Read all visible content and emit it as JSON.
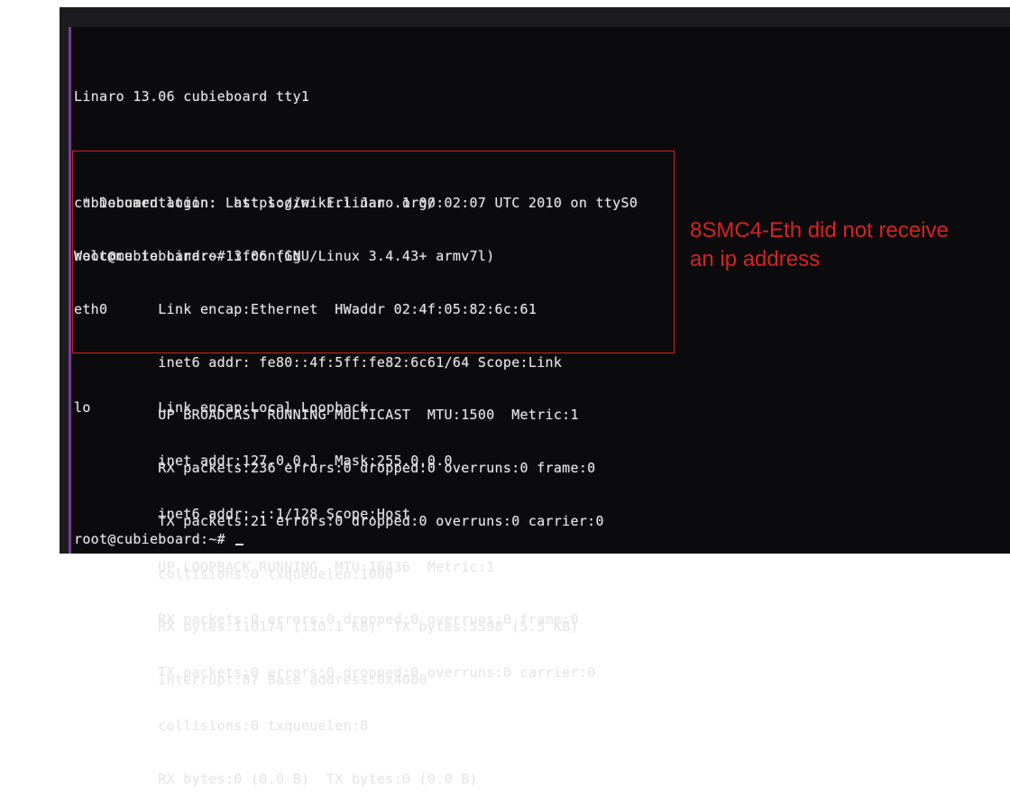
{
  "terminal": {
    "header_lines": [
      "Linaro 13.06 cubieboard tty1",
      "",
      "cubieboard login: Last login: Fri Jan  1 00:02:07 UTC 2010 on ttyS0",
      "Welcome to Linaro 13.06 (GNU/Linux 3.4.43+ armv7l)"
    ],
    "boxed_lines": [
      " * Documentation:  https://wiki.linaro.org/",
      "root@cubieboard:~# ifconfig",
      "eth0      Link encap:Ethernet  HWaddr 02:4f:05:82:6c:61",
      "          inet6 addr: fe80::4f:5ff:fe82:6c61/64 Scope:Link",
      "          UP BROADCAST RUNNING MULTICAST  MTU:1500  Metric:1",
      "          RX packets:236 errors:0 dropped:0 overruns:0 frame:0",
      "          TX packets:21 errors:0 dropped:0 overruns:0 carrier:0",
      "          collisions:0 txqueuelen:1000",
      "          RX bytes:110174 (110.1 KB)  TX bytes:5598 (5.5 KB)",
      "          Interrupt:87 Base address:0x4000"
    ],
    "lo_lines": [
      "lo        Link encap:Local Loopback",
      "          inet addr:127.0.0.1  Mask:255.0.0.0",
      "          inet6 addr: ::1/128 Scope:Host",
      "          UP LOOPBACK RUNNING  MTU:16436  Metric:1",
      "          RX packets:0 errors:0 dropped:0 overruns:0 frame:0",
      "          TX packets:0 errors:0 dropped:0 overruns:0 carrier:0",
      "          collisions:0 txqueuelen:0",
      "          RX bytes:0 (0.0 B)  TX bytes:0 (0.0 B)"
    ],
    "prompt": "root@cubieboard:~# "
  },
  "annotation": {
    "text": "8SMC4-Eth did not receive an ip address",
    "color": "#d62222"
  },
  "colors": {
    "terminal_bg": "#0b0b0d",
    "terminal_fg": "#e4e4e4",
    "bezel": "#1c1c1e",
    "screen_edge": "#7a3e9a",
    "box_border": "#d42020"
  }
}
